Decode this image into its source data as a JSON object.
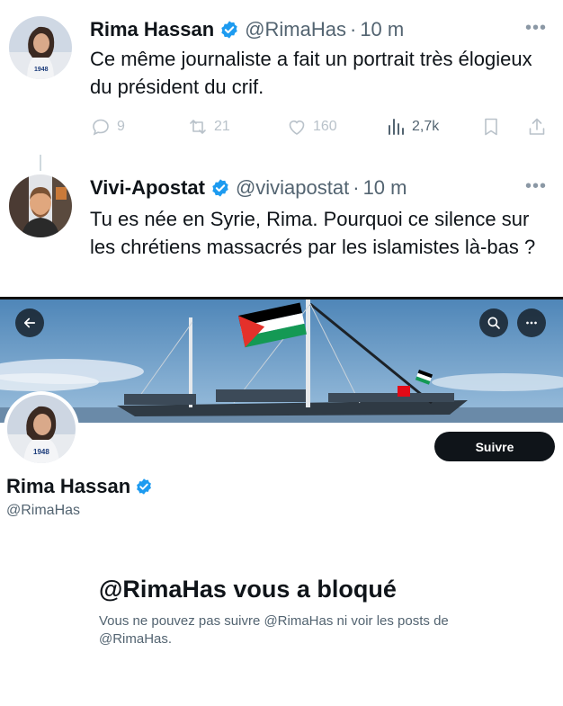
{
  "tweets": [
    {
      "name": "Rima Hassan",
      "handle": "@RimaHas",
      "dot": "·",
      "time": "10 m",
      "more": "•••",
      "text": "Ce même journaliste a fait un portrait très élogieux du président du crif.",
      "actions": {
        "replies": "9",
        "retweets": "21",
        "likes": "160",
        "views": "2,7k"
      }
    },
    {
      "name": "Vivi-Apostat",
      "handle": "@viviapostat",
      "dot": "·",
      "time": "10 m",
      "more": "•••",
      "text": "Tu es née en Syrie, Rima. Pourquoi ce silence sur les chrétiens massacrés par les islamistes là-bas ?"
    }
  ],
  "profile": {
    "name": "Rima Hassan",
    "handle": "@RimaHas",
    "follow_label": "Suivre",
    "blocked_title": "@RimaHas vous a bloqué",
    "blocked_desc": "Vous ne pouvez pas suivre @RimaHas ni voir les posts de @RimaHas.",
    "avatar_shirt_text": "1948"
  },
  "colors": {
    "verified": "#1d9bf0",
    "text_primary": "#0f1419",
    "text_secondary": "#536471",
    "button_dark": "#0f1419"
  },
  "icons": [
    "verified-badge-icon",
    "reply-icon",
    "retweet-icon",
    "like-icon",
    "views-icon",
    "bookmark-icon",
    "share-icon",
    "back-arrow-icon",
    "search-icon",
    "more-icon"
  ]
}
